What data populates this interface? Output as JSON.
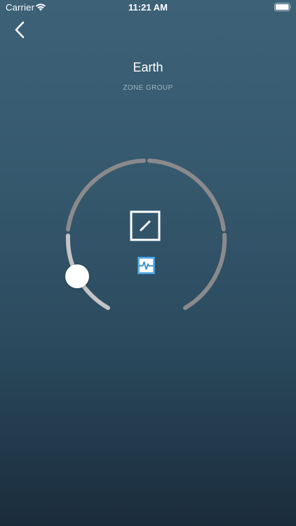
{
  "status_bar": {
    "carrier": "Carrier",
    "time": "11:21 AM",
    "wifi_icon": "wifi-icon",
    "battery_icon": "battery-icon"
  },
  "nav": {
    "back_icon": "chevron-left-icon"
  },
  "zone": {
    "name": "Earth",
    "type": "ZONE GROUP"
  },
  "dial": {
    "level": 0.08,
    "colors": {
      "track": "#8a8a8c",
      "active": "#c4c4c6",
      "knob": "#ffffff"
    }
  },
  "icons": {
    "edit": "edit-square-icon",
    "activity": "activity-pulse-icon"
  },
  "colors": {
    "accent": "#2a8fd6",
    "background_top": "#3d6278",
    "background_bottom": "#1a2c3a"
  }
}
